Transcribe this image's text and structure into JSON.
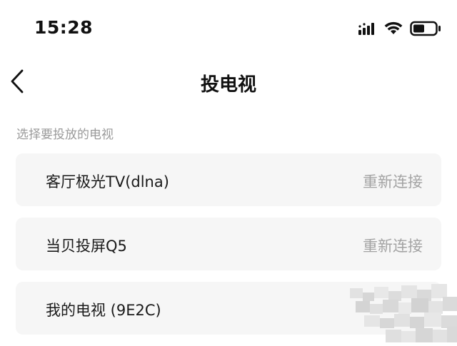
{
  "status_bar": {
    "time": "15:28",
    "icons": [
      "signal-icon",
      "wifi-icon",
      "battery-icon"
    ]
  },
  "nav": {
    "back_icon": "chevron-left-icon",
    "title": "投电视"
  },
  "section_label": "选择要投放的电视",
  "devices": [
    {
      "name": "客厅极光TV(dlna)",
      "action": "重新连接"
    },
    {
      "name": "当贝投屏Q5",
      "action": "重新连接"
    },
    {
      "name": "我的电视 (9E2C)",
      "action": ""
    }
  ],
  "colors": {
    "background": "#ffffff",
    "card": "#f6f6f6",
    "secondary_text": "#a3a3a3"
  }
}
